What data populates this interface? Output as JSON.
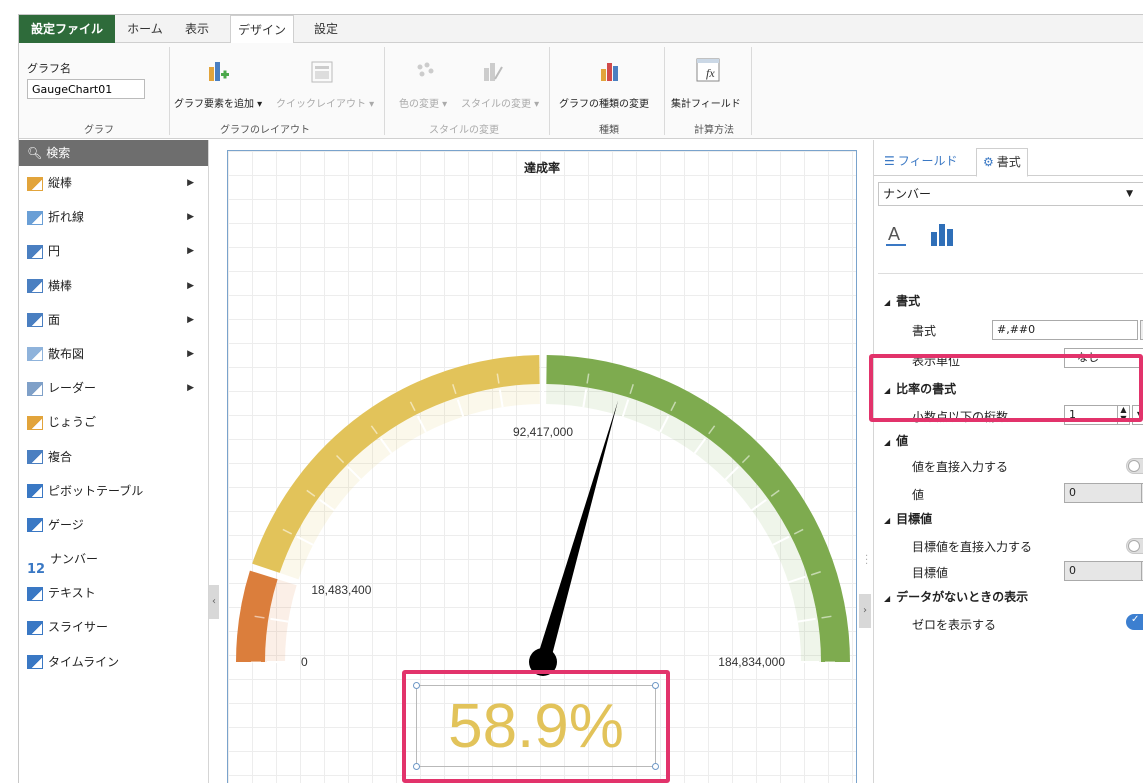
{
  "tabs": {
    "file": "設定ファイル",
    "home": "ホーム",
    "view": "表示",
    "design": "デザイン",
    "settings": "設定"
  },
  "ribbon": {
    "graph_name_label": "グラフ名",
    "graph_name_value": "GaugeChart01",
    "add_element": "グラフ要素を追加",
    "quick_layout": "クイックレイアウト",
    "change_color": "色の変更",
    "change_style": "スタイルの変更",
    "change_type": "グラフの種類の変更",
    "aggregate_field": "集計フィールド",
    "groups": {
      "graph": "グラフ",
      "layout": "グラフのレイアウト",
      "style": "スタイルの変更",
      "type": "種類",
      "calc": "計算方法"
    }
  },
  "left": {
    "search": "検索",
    "items": [
      {
        "label": "縦棒",
        "icon": "column-chart-icon",
        "arrow": true
      },
      {
        "label": "折れ線",
        "icon": "line-chart-icon",
        "arrow": true
      },
      {
        "label": "円",
        "icon": "pie-chart-icon",
        "arrow": true
      },
      {
        "label": "横棒",
        "icon": "bar-chart-icon",
        "arrow": true
      },
      {
        "label": "面",
        "icon": "area-chart-icon",
        "arrow": true
      },
      {
        "label": "散布図",
        "icon": "scatter-chart-icon",
        "arrow": true
      },
      {
        "label": "レーダー",
        "icon": "radar-chart-icon",
        "arrow": true
      },
      {
        "label": "じょうご",
        "icon": "funnel-chart-icon",
        "arrow": false
      },
      {
        "label": "複合",
        "icon": "combo-chart-icon",
        "arrow": false
      },
      {
        "label": "ピボットテーブル",
        "icon": "pivot-table-icon",
        "arrow": false
      },
      {
        "label": "ゲージ",
        "icon": "gauge-icon",
        "arrow": false
      },
      {
        "label": "ナンバー",
        "icon_text": "12",
        "icon": "number-icon",
        "arrow": false
      },
      {
        "label": "テキスト",
        "icon": "text-icon",
        "arrow": false
      },
      {
        "label": "スライサー",
        "icon": "slicer-icon",
        "arrow": false
      },
      {
        "label": "タイムライン",
        "icon": "timeline-icon",
        "arrow": false
      }
    ]
  },
  "chart_data": {
    "type": "gauge",
    "title": "達成率",
    "min": 0,
    "max": 184834000,
    "bands": [
      {
        "from": 0,
        "to": 18483400,
        "color": "#db7e3c"
      },
      {
        "from": 18483400,
        "to": 92417000,
        "color": "#e2c35a"
      },
      {
        "from": 92417000,
        "to": 184834000,
        "color": "#7eab4f"
      }
    ],
    "labels": {
      "min": "0",
      "low": "18,483,400",
      "mid": "92,417,000",
      "max": "184,834,000"
    },
    "value_ratio": 0.589,
    "value_label": "58.9%",
    "value_color": "#e2c35a"
  },
  "right": {
    "tab_fields": "フィールド",
    "tab_format": "書式",
    "number_select": "ナンバー",
    "sections": {
      "format": "書式",
      "ratio_format": "比率の書式",
      "value": "値",
      "target": "目標値",
      "nodata": "データがないときの表示"
    },
    "props": {
      "format_label": "書式",
      "format_value": "#,##0",
      "unit_label": "表示単位",
      "unit_value": "なし",
      "decimal_label": "小数点以下の桁数",
      "decimal_value": "1",
      "direct_value_label": "値を直接入力する",
      "value_label": "値",
      "value_value": "0",
      "direct_target_label": "目標値を直接入力する",
      "target_label": "目標値",
      "target_value": "0",
      "show_zero_label": "ゼロを表示する"
    }
  }
}
